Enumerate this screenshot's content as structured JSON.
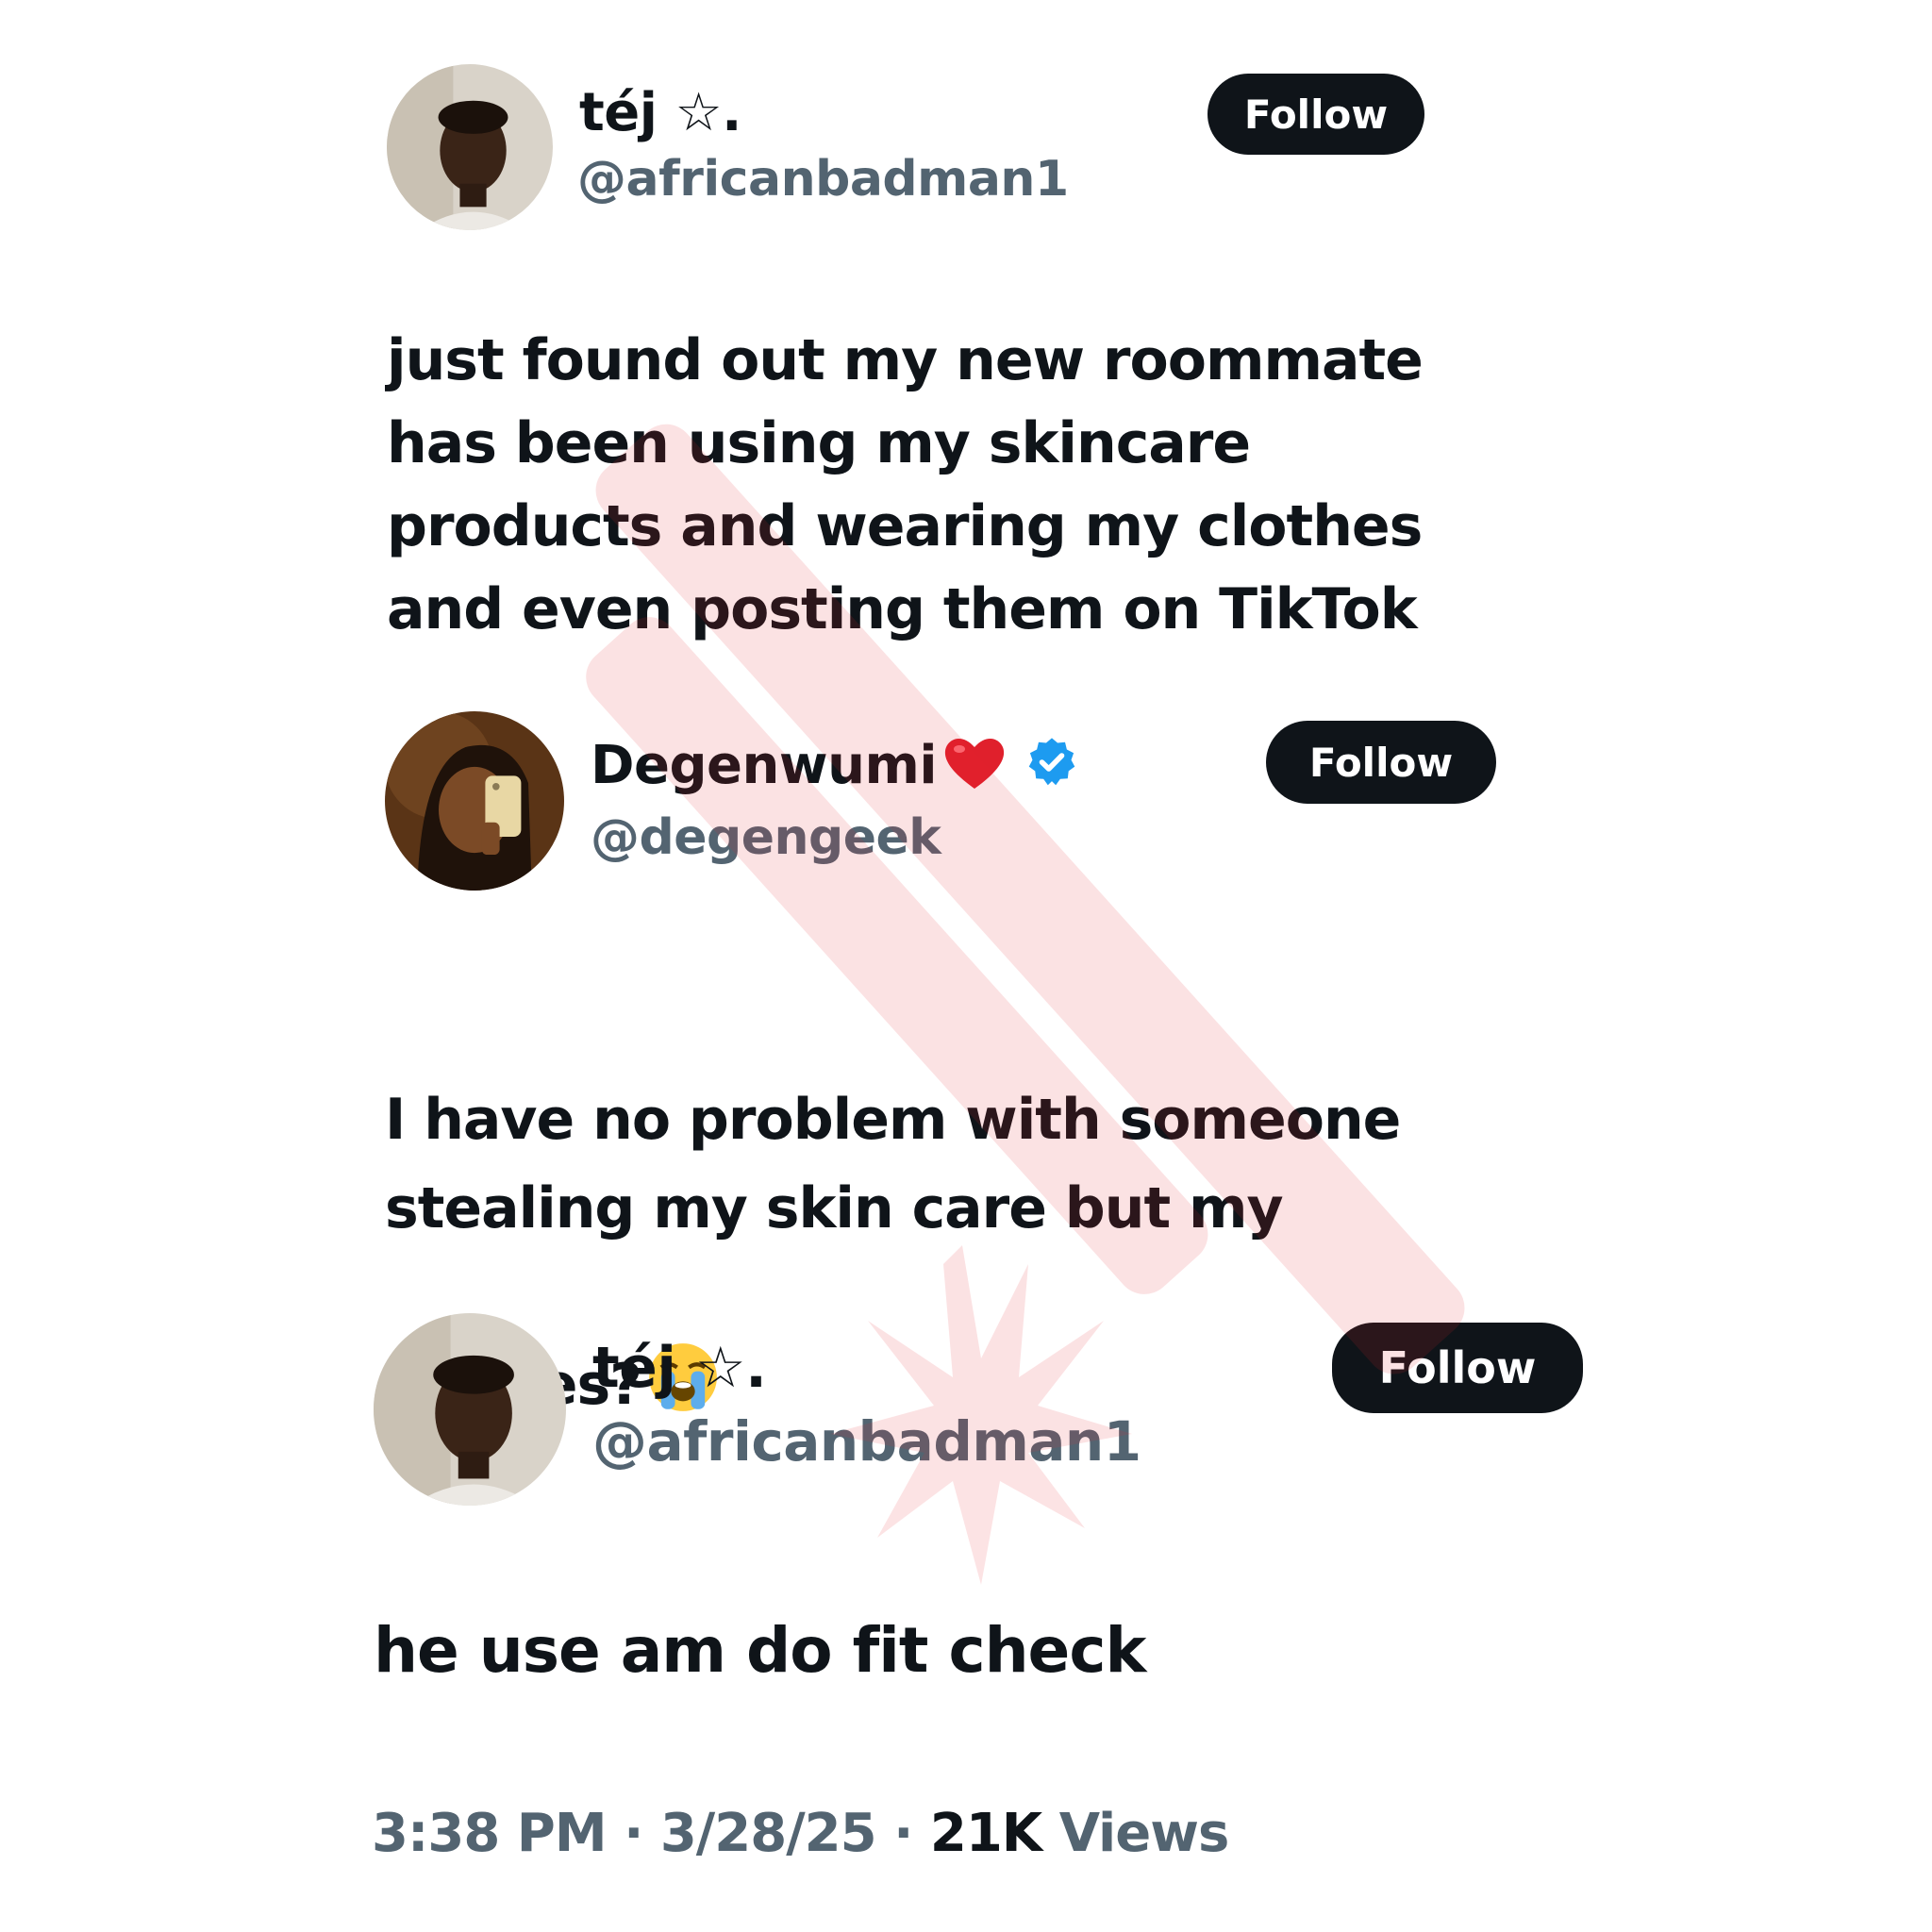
{
  "tweets": [
    {
      "display_name": "téj ☆.",
      "handle": "@africanbadman1",
      "follow_label": "Follow",
      "text": "just found out my new roommate\nhas been using my skincare\nproducts and wearing my clothes\nand even posting them on TikTok"
    },
    {
      "display_name": "Degenwumi",
      "name_emoji": "heart-emoji",
      "verified": true,
      "handle": "@degengeek",
      "follow_label": "Follow",
      "text": "I have no problem with someone\nstealing my skin care but my\nclothes?",
      "text_emoji": "loudly-crying-face-emoji"
    },
    {
      "display_name": "téj ☆.",
      "handle": "@africanbadman1",
      "follow_label": "Follow",
      "text": "he use am do fit check"
    }
  ],
  "footer": {
    "time": "3:38 PM",
    "separator": "·",
    "date": "3/28/25",
    "views_count": "21K",
    "views_label": "Views"
  },
  "colors": {
    "text": "#0f1419",
    "secondary": "#536471",
    "follow_bg": "#0f1419",
    "verified": "#1d9bf0",
    "watermark": "#e8252f"
  }
}
